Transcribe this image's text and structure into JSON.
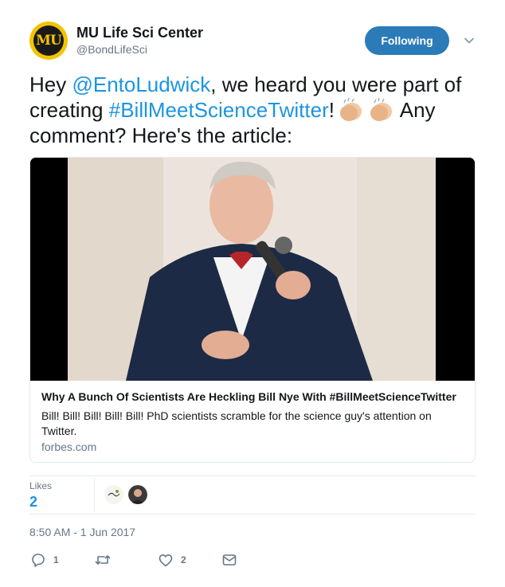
{
  "account": {
    "name": "MU Life Sci Center",
    "handle": "@BondLifeSci",
    "avatar_letters": "MU"
  },
  "follow_button": {
    "label": "Following"
  },
  "tweet": {
    "text_before_mention": "Hey ",
    "mention": "@EntoLudwick",
    "text_mid": ", we heard you were part of creating ",
    "hashtag": "#BillMeetScienceTwitter",
    "text_after_hashtag": "!",
    "text_end": " Any comment? Here's the article:"
  },
  "card": {
    "title": "Why A Bunch Of Scientists Are Heckling Bill Nye With #BillMeetScienceTwitter",
    "description": "Bill! Bill! Bill! Bill! Bill! PhD scientists scramble for the science guy's attention on Twitter.",
    "domain": "forbes.com"
  },
  "stats": {
    "likes_label": "Likes",
    "likes_count": "2"
  },
  "timestamp": "8:50 AM - 1 Jun 2017",
  "actions": {
    "reply_count": "1",
    "retweet_count": "",
    "like_count": "2"
  },
  "colors": {
    "link": "#1b95e0",
    "follow_button": "#2b7bb9",
    "secondary_text": "#657786",
    "avatar_gold": "#f3c300"
  },
  "icons": [
    "chevron-down-icon",
    "clap-emoji-icon",
    "reply-icon",
    "retweet-icon",
    "heart-icon",
    "message-icon"
  ]
}
